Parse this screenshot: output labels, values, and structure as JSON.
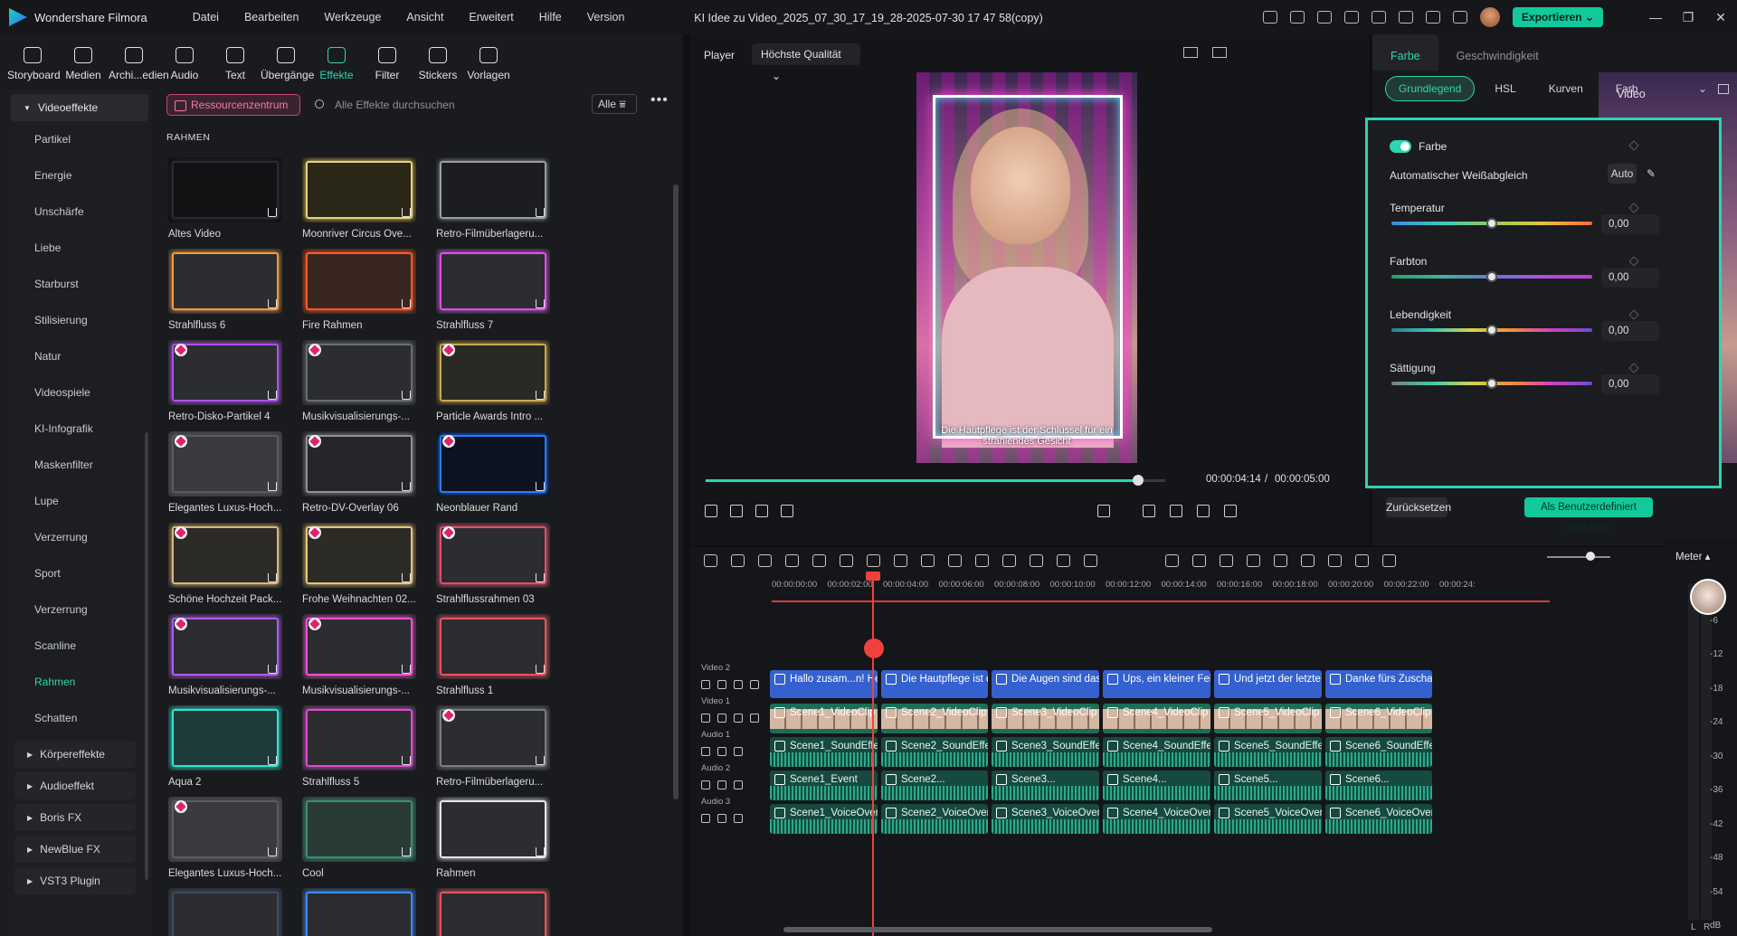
{
  "titlebar": {
    "app_name": "Wondershare Filmora",
    "menu": [
      "Datei",
      "Bearbeiten",
      "Werkzeuge",
      "Ansicht",
      "Erweitert",
      "Hilfe",
      "Version"
    ],
    "document_title": "KI Idee zu Video_2025_07_30_17_19_28-2025-07-30 17 47 58(copy)",
    "export_label": "Exportieren",
    "icons": [
      "gift-icon",
      "send-icon",
      "dialog-icon",
      "layout-icon",
      "save-icon",
      "cloud-icon",
      "headset-icon",
      "grid-icon"
    ]
  },
  "toolbar": {
    "tools": [
      {
        "label": "Storyboard",
        "icon": "storyboard-icon"
      },
      {
        "label": "Medien",
        "icon": "media-icon"
      },
      {
        "label": "Archi...edien",
        "icon": "archive-icon"
      },
      {
        "label": "Audio",
        "icon": "music-icon"
      },
      {
        "label": "Text",
        "icon": "text-icon"
      },
      {
        "label": "Übergänge",
        "icon": "transition-icon"
      },
      {
        "label": "Effekte",
        "icon": "effects-icon",
        "active": true
      },
      {
        "label": "Filter",
        "icon": "filter-icon"
      },
      {
        "label": "Stickers",
        "icon": "sticker-icon"
      },
      {
        "label": "Vorlagen",
        "icon": "template-icon"
      }
    ]
  },
  "sidebar": {
    "head": "Videoeffekte",
    "items": [
      "Partikel",
      "Energie",
      "Unschärfe",
      "Liebe",
      "Starburst",
      "Stilisierung",
      "Natur",
      "Videospiele",
      "KI-Infografik",
      "Maskenfilter",
      "Lupe",
      "Verzerrung",
      "Sport",
      "Verzerrung",
      "Scanline",
      "Rahmen",
      "Schatten"
    ],
    "active": "Rahmen",
    "groups": [
      "Körpereffekte",
      "Audioeffekt",
      "Boris FX",
      "NewBlue FX",
      "VST3 Plugin"
    ]
  },
  "effects": {
    "resource_center": "Ressourcenzentrum",
    "search_placeholder": "Alle Effekte durchsuchen",
    "filter": "Alle",
    "section": "RAHMEN",
    "cards": [
      {
        "label": "Altes Video",
        "color": "#111214",
        "border": "#2a2b2e",
        "premium": false
      },
      {
        "label": "Moonriver Circus Ove...",
        "color": "#2b2717",
        "border": "#e9d37a",
        "premium": false
      },
      {
        "label": "Retro-Filmüberlageru...",
        "color": "#1b1d22",
        "border": "#9a9da3",
        "premium": false
      },
      {
        "label": "Strahlfluss 6",
        "color": "#2b2d31",
        "border": "#f59a3a",
        "premium": false
      },
      {
        "label": "Fire Rahmen",
        "color": "#3a2620",
        "border": "#ff5a22",
        "premium": false
      },
      {
        "label": "Strahlfluss 7",
        "color": "#2b2d31",
        "border": "#e14cf0",
        "premium": false
      },
      {
        "label": "Retro-Disko-Partikel 4",
        "color": "#2b2d31",
        "border": "#b04df0",
        "premium": true
      },
      {
        "label": "Musikvisualisierungs-...",
        "color": "#2b2d31",
        "border": "#6a6c70",
        "premium": true
      },
      {
        "label": "Particle Awards Intro ...",
        "color": "#2b2924",
        "border": "#c9a84f",
        "premium": true
      },
      {
        "label": "Elegantes Luxus-Hoch...",
        "color": "#3a3b3e",
        "border": "#5a5b5e",
        "premium": true
      },
      {
        "label": "Retro-DV-Overlay 06",
        "color": "#25262a",
        "border": "#8f9195",
        "premium": true
      },
      {
        "label": "Neonblauer Rand",
        "color": "#0c1220",
        "border": "#2a7bff",
        "premium": true
      },
      {
        "label": "Schöne Hochzeit Pack...",
        "color": "#2c2b28",
        "border": "#d8b878",
        "premium": true
      },
      {
        "label": "Frohe Weihnachten 02...",
        "color": "#2d2b26",
        "border": "#e5c67a",
        "premium": true
      },
      {
        "label": "Strahlflussrahmen 03",
        "color": "#2b2d31",
        "border": "#e74b6a",
        "premium": true
      },
      {
        "label": "Musikvisualisierungs-...",
        "color": "#2b2d31",
        "border": "#b556ff",
        "premium": true
      },
      {
        "label": "Musikvisualisierungs-...",
        "color": "#2b2d31",
        "border": "#ff4fd8",
        "premium": true
      },
      {
        "label": "Strahlfluss 1",
        "color": "#2b2d31",
        "border": "#f05060",
        "premium": false
      },
      {
        "label": "Aqua 2",
        "color": "#1e3b3a",
        "border": "#2fe4d2",
        "premium": false
      },
      {
        "label": "Strahlfluss 5",
        "color": "#2b2d31",
        "border": "#e04ad0",
        "premium": false
      },
      {
        "label": "Retro-Filmüberlageru...",
        "color": "#2b2d31",
        "border": "#7a7c80",
        "premium": true
      },
      {
        "label": "Elegantes Luxus-Hoch...",
        "color": "#3a3b3e",
        "border": "#5a5b5e",
        "premium": true
      },
      {
        "label": "Cool",
        "color": "#2a3b36",
        "border": "#3a8c78",
        "premium": false
      },
      {
        "label": "Rahmen",
        "color": "#2b2d31",
        "border": "#e5e6e9",
        "premium": false
      },
      {
        "label": "",
        "color": "#2b2d31",
        "border": "#3a4b66",
        "premium": false
      },
      {
        "label": "",
        "color": "#2b2d31",
        "border": "#3a8cff",
        "premium": false
      },
      {
        "label": "",
        "color": "#2b2d31",
        "border": "#f05060",
        "premium": false
      }
    ]
  },
  "player": {
    "label": "Player",
    "quality": "Höchste Qualität",
    "subtitle": "Die Hautpflege ist der Schlüssel für ein strahlendes Gesicht",
    "current_time": "00:00:04:14",
    "total_time": "00:00:05:00",
    "progress": 0.94
  },
  "properties": {
    "tabs": [
      "Video",
      "Farbe",
      "Geschwindigkeit"
    ],
    "active_tab": "Farbe",
    "subtabs": [
      "Grundlegend",
      "HSL",
      "Kurven",
      "Farb"
    ],
    "active_subtab": "Grundlegend",
    "section": "Farbe",
    "awb_label": "Automatischer Weißabgleich",
    "auto_label": "Auto",
    "sliders": [
      {
        "label": "Temperatur",
        "value": "0,00",
        "pos": 0.5,
        "cls": "s-temp"
      },
      {
        "label": "Farbton",
        "value": "0,00",
        "pos": 0.5,
        "cls": "s-tint"
      },
      {
        "label": "Lebendigkeit",
        "value": "0,00",
        "pos": 0.5,
        "cls": "s-vib"
      },
      {
        "label": "Sättigung",
        "value": "0,00",
        "pos": 0.5,
        "cls": "s-sat"
      }
    ],
    "reset": "Zurücksetzen",
    "save_custom": "Als Benutzerdefiniert speichern"
  },
  "timeline": {
    "ruler": [
      "00:00:00:00",
      "00:00:02:00",
      "00:00:04:00",
      "00:00:06:00",
      "00:00:08:00",
      "00:00:10:00",
      "00:00:12:00",
      "00:00:14:00",
      "00:00:16:00",
      "00:00:18:00",
      "00:00:20:00",
      "00:00:22:00",
      "00:00:24:"
    ],
    "tracks": [
      "Video 2",
      "Video 1",
      "Audio 1",
      "Audio 2",
      "Audio 3"
    ],
    "text_clips": [
      "Hallo zusam...n! He...",
      "Die Hautpflege ist de...",
      "Die Augen sind das ...",
      "Ups, ein kleiner Fehle...",
      "Und jetzt der letzte S...",
      "Danke fürs Zuschaue..."
    ],
    "video_clips": [
      "Scene1_VideoClip",
      "Scene2_VideoClip",
      "Scene3_VideoClip",
      "Scene4_VideoClip",
      "Scene5_VideoClip",
      "Scene6_VideoClip"
    ],
    "audio1_clips": [
      "Scene1_SoundEffect",
      "Scene2_SoundEffect",
      "Scene3_SoundEffect",
      "Scene4_SoundEffect",
      "Scene5_SoundEffect",
      "Scene6_SoundEffect"
    ],
    "audio2_clips": [
      "Scene1_Event",
      "Scene2...",
      "Scene3...",
      "Scene4...",
      "Scene5...",
      "Scene6..."
    ],
    "audio3_clips": [
      "Scene1_VoiceOver",
      "Scene2_VoiceOver",
      "Scene3_VoiceOver",
      "Scene4_VoiceOver",
      "Scene5_VoiceOver",
      "Scene6_VoiceOver"
    ],
    "meter_label": "Meter",
    "meter_ticks": [
      "0",
      "-6",
      "-12",
      "-18",
      "-24",
      "-30",
      "-36",
      "-42",
      "-48",
      "-54",
      "dB"
    ],
    "channels": [
      "L",
      "R"
    ]
  }
}
